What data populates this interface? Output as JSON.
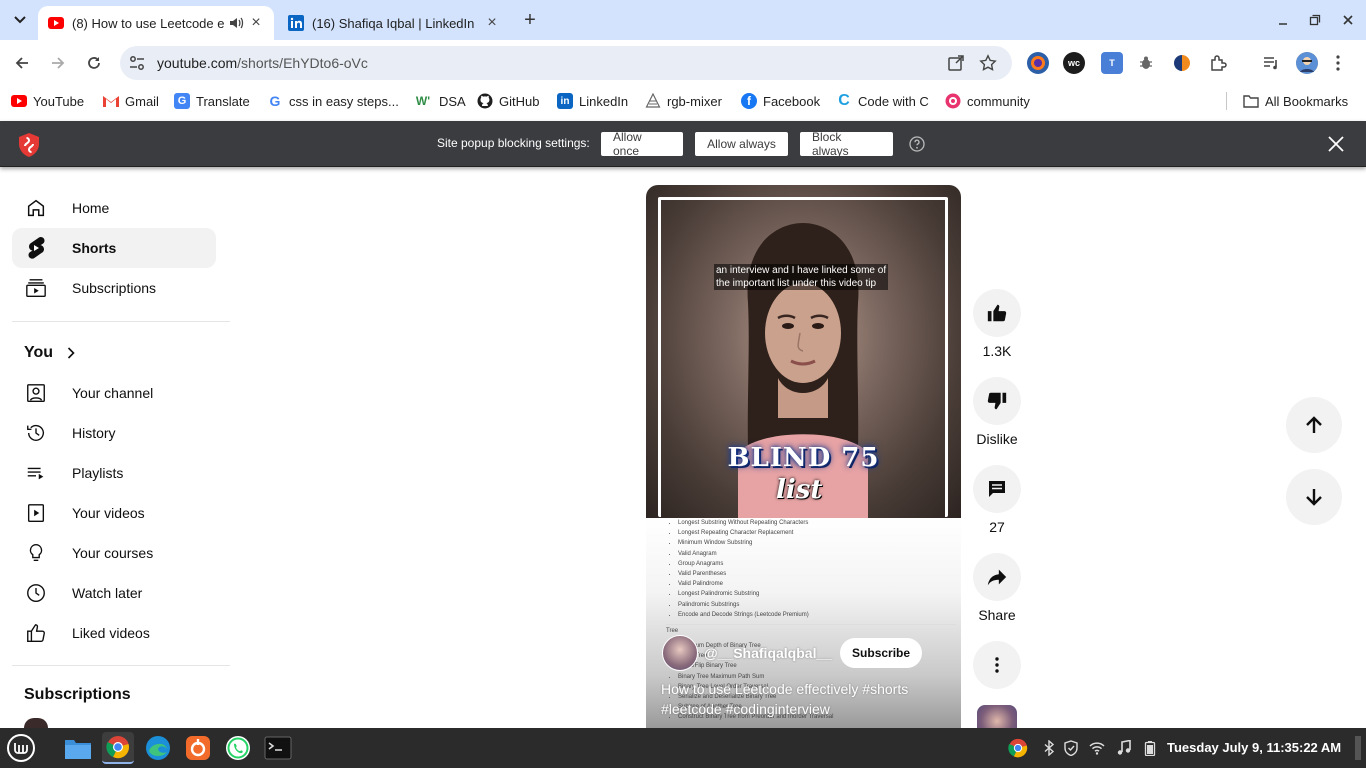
{
  "browser": {
    "tabs": [
      {
        "title": "(8) How to use Leetcode effectively #shorts",
        "active": true
      },
      {
        "title": "(16) Shafiqa Iqbal | LinkedIn",
        "active": false
      }
    ],
    "url_main": "youtube.com",
    "url_path": "/shorts/EhYDto6-oVc"
  },
  "bookmarks": [
    {
      "label": "YouTube",
      "icon": "youtube-icon"
    },
    {
      "label": "Gmail",
      "icon": "gmail-icon"
    },
    {
      "label": "Translate",
      "icon": "translate-icon"
    },
    {
      "label": "css in easy steps...",
      "icon": "google-icon"
    },
    {
      "label": "DSA",
      "icon": "dsa-icon"
    },
    {
      "label": "GitHub",
      "icon": "github-icon"
    },
    {
      "label": "LinkedIn",
      "icon": "linkedin-icon"
    },
    {
      "label": "rgb-mixer",
      "icon": "rgb-mixer-icon"
    },
    {
      "label": "Facebook",
      "icon": "facebook-icon"
    },
    {
      "label": "Code with C",
      "icon": "codewithc-icon"
    },
    {
      "label": "community",
      "icon": "community-icon"
    }
  ],
  "all_bookmarks": "All Bookmarks",
  "popup": {
    "label": "Site popup blocking settings:",
    "allow_once": "Allow once",
    "allow_always": "Allow always",
    "block_always": "Block always"
  },
  "sidebar": {
    "main": [
      {
        "label": "Home",
        "icon": "home-icon"
      },
      {
        "label": "Shorts",
        "icon": "shorts-icon",
        "active": true
      },
      {
        "label": "Subscriptions",
        "icon": "subscriptions-icon"
      }
    ],
    "you_heading": "You",
    "you_items": [
      {
        "label": "Your channel",
        "icon": "channel-icon"
      },
      {
        "label": "History",
        "icon": "history-icon"
      },
      {
        "label": "Playlists",
        "icon": "playlists-icon"
      },
      {
        "label": "Your videos",
        "icon": "your-videos-icon"
      },
      {
        "label": "Your courses",
        "icon": "courses-icon"
      },
      {
        "label": "Watch later",
        "icon": "watch-later-icon"
      },
      {
        "label": "Liked videos",
        "icon": "liked-icon"
      }
    ],
    "subscriptions_heading": "Subscriptions"
  },
  "short": {
    "caption_line1": "an interview and I have linked some of",
    "caption_line2": "the important list under this video tip",
    "overlay_title": "BLIND 75",
    "overlay_subtitle": "list",
    "list_items": [
      "Longest Substring Without Repeating Characters",
      "Longest Repeating Character Replacement",
      "Minimum Window Substring",
      "Valid Anagram",
      "Group Anagrams",
      "Valid Parentheses",
      "Valid Palindrome",
      "Longest Palindromic Substring",
      "Palindromic Substrings",
      "Encode and Decode Strings (Leetcode Premium)"
    ],
    "tree_heading": "Tree",
    "tree_items": [
      "Maximum Depth of Binary Tree",
      "Same Tree",
      "Invert/Flip Binary Tree",
      "Binary Tree Maximum Path Sum",
      "Binary Tree Level Order Traversal",
      "Serialize and Deserialize Binary Tree",
      "Subtree of Another Tree",
      "Construct Binary Tree from Preorder and Inorder Traversal"
    ],
    "channel": "@__Shafiqalqbal__",
    "subscribe": "Subscribe",
    "title": "How to use Leetcode effectively #shorts #leetcode #codinginterview"
  },
  "actions": {
    "likes": "1.3K",
    "dislike": "Dislike",
    "comments": "27",
    "share": "Share"
  },
  "taskbar": {
    "clock": "Tuesday July  9, 11:35:22 AM"
  },
  "colors": {
    "tabstrip": "#d3e3fd",
    "popupbar": "#3b3c40",
    "youtube_red": "#ff0000"
  }
}
